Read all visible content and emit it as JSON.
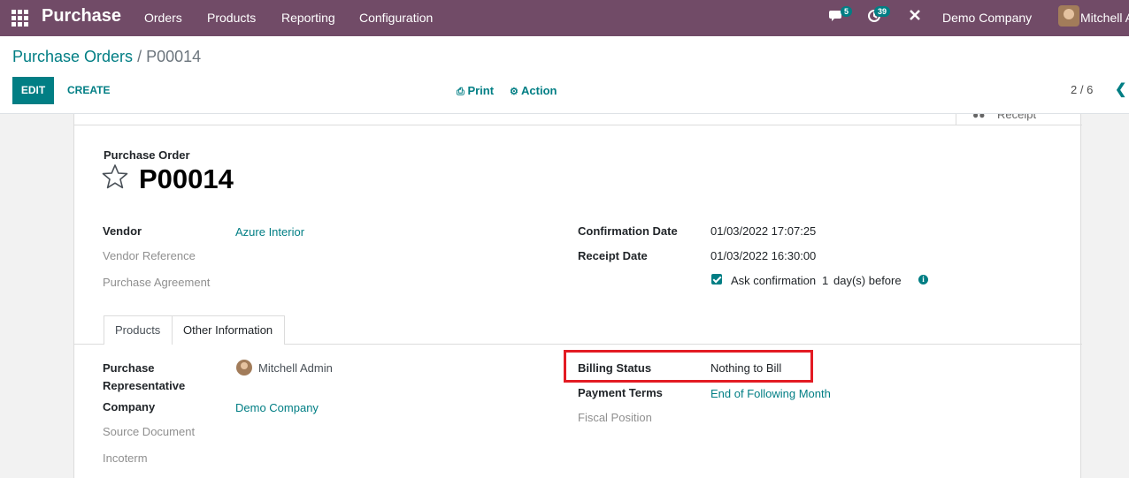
{
  "navbar": {
    "app_name": "Purchase",
    "menu": [
      "Orders",
      "Products",
      "Reporting",
      "Configuration"
    ],
    "messages_count": "5",
    "activities_count": "39",
    "company": "Demo Company",
    "user": "Mitchell A",
    "brand_color": "#714B67"
  },
  "breadcrumb": {
    "parent": "Purchase Orders",
    "separator": "/",
    "current": "P00014"
  },
  "toolbar": {
    "edit": "EDIT",
    "create": "CREATE",
    "print": "Print",
    "action": "Action",
    "pager": "2 / 6"
  },
  "smart_button": {
    "receipt": "Receipt"
  },
  "form": {
    "doc_label": "Purchase Order",
    "name": "P00014",
    "vendor_label": "Vendor",
    "vendor": "Azure Interior",
    "vendor_ref_label": "Vendor Reference",
    "agreement_label": "Purchase Agreement",
    "confirmation_date_label": "Confirmation Date",
    "confirmation_date": "01/03/2022 17:07:25",
    "receipt_date_label": "Receipt Date",
    "receipt_date": "01/03/2022 16:30:00",
    "ask_confirmation_label": "Ask confirmation",
    "ask_confirmation_days": "1",
    "ask_confirmation_suffix": "day(s) before"
  },
  "tabs": [
    "Products",
    "Other Information"
  ],
  "other_info": {
    "representative_label_1": "Purchase",
    "representative_label_2": "Representative",
    "representative": "Mitchell Admin",
    "company_label": "Company",
    "company": "Demo Company",
    "source_doc_label": "Source Document",
    "incoterm_label": "Incoterm",
    "billing_status_label": "Billing Status",
    "billing_status": "Nothing to Bill",
    "payment_terms_label": "Payment Terms",
    "payment_terms": "End of Following Month",
    "fiscal_position_label": "Fiscal Position"
  },
  "colors": {
    "accent": "#017e84",
    "highlight": "#e31b23"
  }
}
